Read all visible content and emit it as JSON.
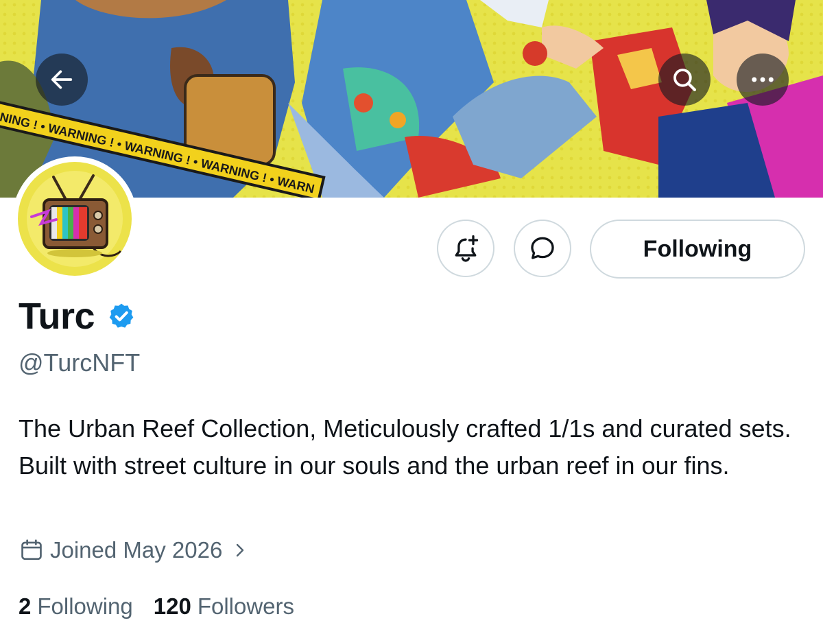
{
  "header": {
    "back_icon": "arrow-left-icon",
    "search_icon": "search-icon",
    "more_icon": "more-horizontal-icon"
  },
  "banner": {
    "tape_text": "WARNING !",
    "colors": {
      "background": "#e6e34a",
      "tape": "#f2d11c",
      "magenta": "#d62fae"
    }
  },
  "actions": {
    "notify_icon": "bell-plus-icon",
    "message_icon": "message-bubble-icon",
    "following_label": "Following"
  },
  "profile": {
    "display_name": "Turc",
    "verified_icon": "verified-badge-icon",
    "verified_color": "#1d9bf0",
    "handle": "@TurcNFT",
    "bio": "The Urban Reef Collection, Meticulously crafted 1/1s and curated sets. Built with street culture in our souls and the urban reef in our fins.",
    "joined_text": "Joined May 2026",
    "joined_icon": "calendar-icon",
    "joined_chevron_icon": "chevron-right-icon"
  },
  "stats": {
    "following_count": "2",
    "following_label": "Following",
    "followers_count": "120",
    "followers_label": "Followers"
  },
  "theme": {
    "text_primary": "#0f1419",
    "text_secondary": "#536471",
    "border": "#cfd9de"
  }
}
